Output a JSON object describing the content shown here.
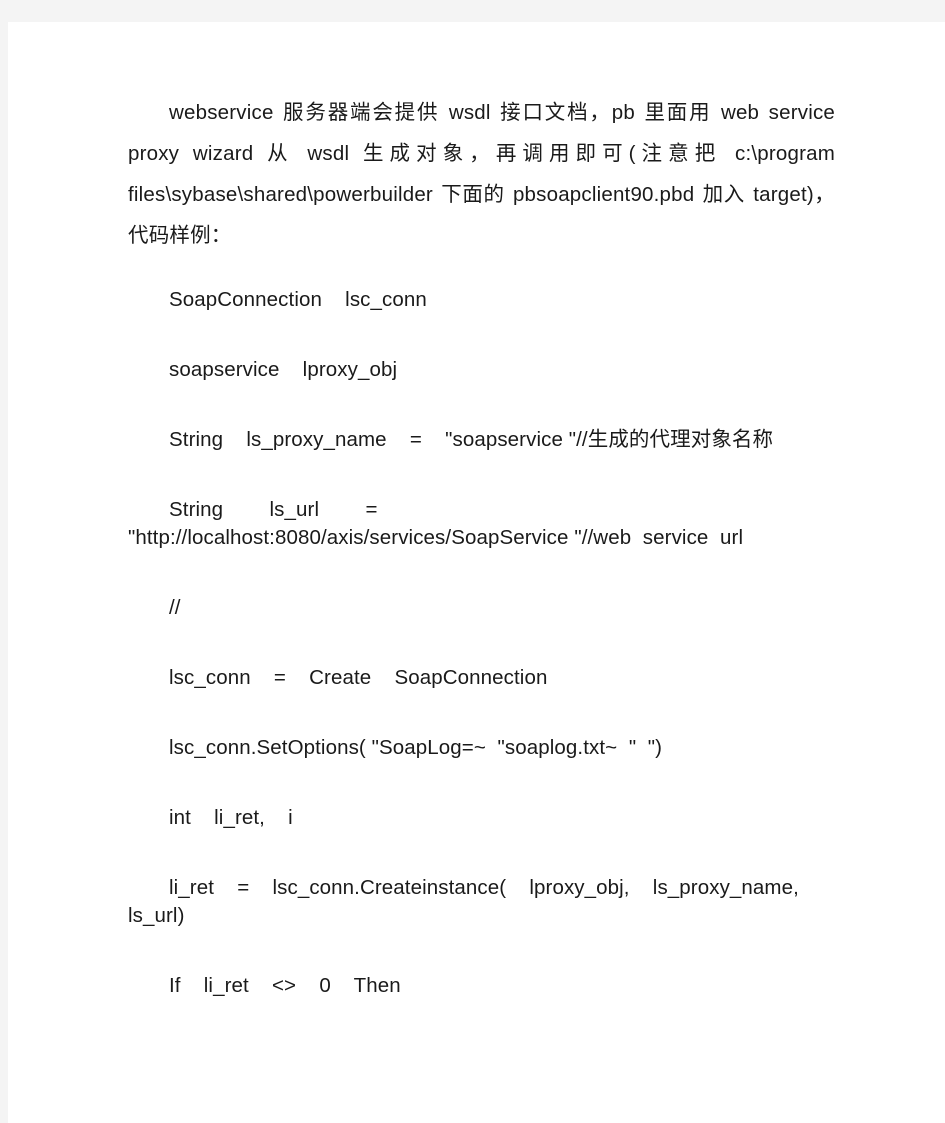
{
  "document": {
    "page_background": "#f4f4f4",
    "sheet_background": "#ffffff",
    "text_color": "#1a1a1a",
    "paragraph": {
      "text": "webservice 服务器端会提供 wsdl 接口文档，pb 里面用 web service proxy wizard 从 wsdl 生成对象，再调用即可(注意把 c:\\program files\\sybase\\shared\\powerbuilder 下面的 pbsoapclient90.pbd 加入 target)，代码样例："
    },
    "code_lines": [
      {
        "text": "SoapConnection    lsc_conn"
      },
      {
        "text": "soapservice    lproxy_obj"
      },
      {
        "text": "String    ls_proxy_name    =    \"soapservice \"//生成的代理对象名称"
      },
      {
        "text": "String        ls_url        =        \"http://localhost:8080/axis/services/SoapService \"//web  service  url"
      },
      {
        "text": "//"
      },
      {
        "text": "lsc_conn    =    Create    SoapConnection"
      },
      {
        "text": "lsc_conn.SetOptions( \"SoapLog=~  \"soaplog.txt~  \"  \")"
      },
      {
        "text": "int    li_ret,    i"
      },
      {
        "text": "li_ret    =    lsc_conn.Createinstance(    lproxy_obj,    ls_proxy_name,    ls_url)"
      },
      {
        "text": "If    li_ret    <>    0    Then"
      }
    ]
  }
}
